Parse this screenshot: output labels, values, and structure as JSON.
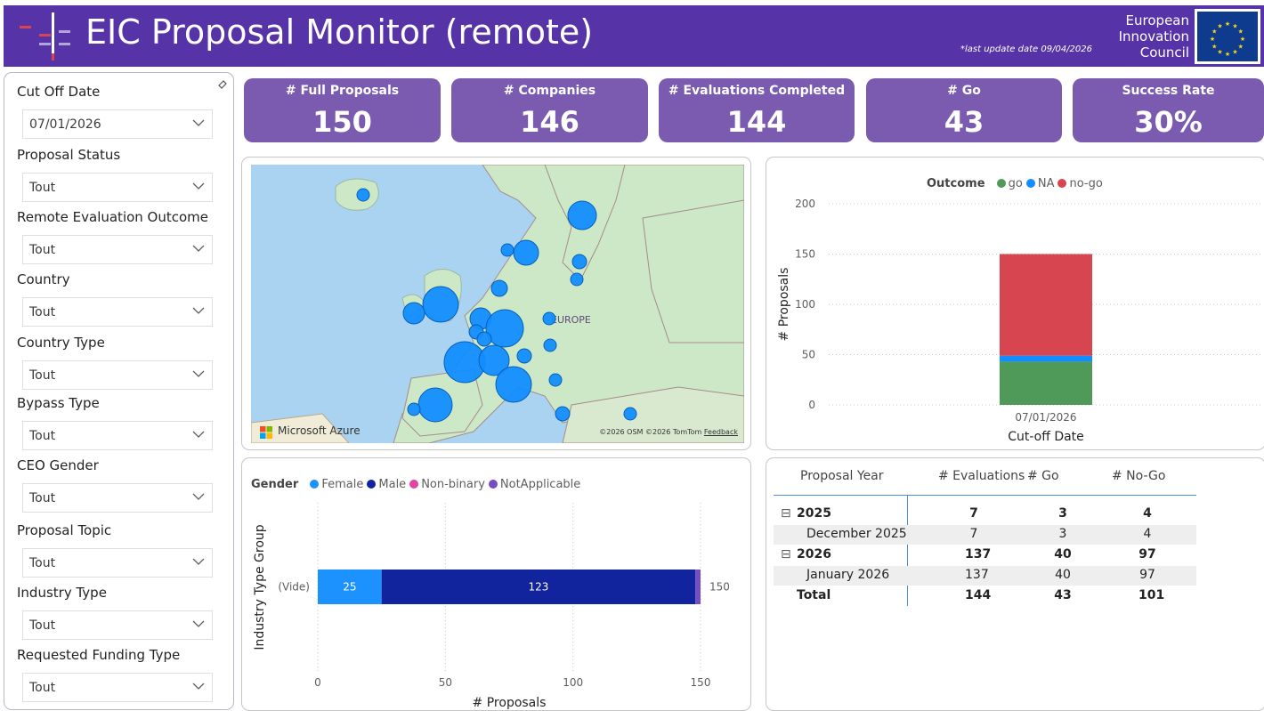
{
  "header": {
    "title": "EIC Proposal Monitor (remote)",
    "last_update": "*last update date 09/04/2026",
    "org_line1": "European",
    "org_line2": "Innovation",
    "org_line3": "Council",
    "logo_icon": "eic-logo-icon",
    "flag_icon": "eu-flag-icon"
  },
  "slicers": [
    {
      "label": "Cut Off Date",
      "value": "07/01/2026"
    },
    {
      "label": "Proposal Status",
      "value": "Tout"
    },
    {
      "label": "Remote Evaluation Outcome",
      "value": "Tout"
    },
    {
      "label": "Country",
      "value": "Tout"
    },
    {
      "label": "Country Type",
      "value": "Tout"
    },
    {
      "label": "Bypass Type",
      "value": "Tout"
    },
    {
      "label": "CEO Gender",
      "value": "Tout"
    },
    {
      "label": "Proposal Topic",
      "value": "Tout"
    },
    {
      "label": "Industry Type",
      "value": "Tout"
    },
    {
      "label": "Requested Funding Type",
      "value": "Tout"
    }
  ],
  "kpis": [
    {
      "label": "# Full Proposals",
      "value": "150"
    },
    {
      "label": "# Companies",
      "value": "146"
    },
    {
      "label": "# Evaluations Completed",
      "value": "144"
    },
    {
      "label": "# Go",
      "value": "43"
    },
    {
      "label": "Success Rate",
      "value": "30%"
    }
  ],
  "map": {
    "region_label": "EUROPE",
    "provider": "Microsoft Azure",
    "credit1": "©2026 OSM",
    "credit2": "©2026 TomTom",
    "credit3": "Feedback",
    "bubble_color": "#118dff"
  },
  "colors": {
    "header": "#5633a7",
    "kpi": "#7a5bb0",
    "go": "#4f9a59",
    "na": "#118dff",
    "nogo": "#d64550",
    "female": "#1c92ff",
    "male": "#12239e",
    "nonbinary": "#e044a7",
    "notapplicable": "#744ec2"
  },
  "outcome_chart": {
    "legend_title": "Outcome",
    "chart_data": {
      "type": "bar",
      "stacked": true,
      "categories": [
        "07/01/2026"
      ],
      "series": [
        {
          "name": "go",
          "values": [
            43
          ]
        },
        {
          "name": "NA",
          "values": [
            6
          ]
        },
        {
          "name": "no-go",
          "values": [
            101
          ]
        }
      ],
      "xlabel": "Cut-off Date",
      "ylabel": "# Proposals",
      "ylim": [
        0,
        200
      ],
      "yticks": [
        "0",
        "50",
        "100",
        "150",
        "200"
      ],
      "grid": true,
      "legend": "top"
    }
  },
  "gender_chart": {
    "legend_title": "Gender",
    "chart_data": {
      "type": "bar",
      "orientation": "horizontal",
      "stacked": true,
      "categories": [
        "(Vide)"
      ],
      "series": [
        {
          "name": "Female",
          "values": [
            25
          ]
        },
        {
          "name": "Male",
          "values": [
            123
          ]
        },
        {
          "name": "Non-binary",
          "values": [
            0
          ]
        },
        {
          "name": "NotApplicable",
          "values": [
            2
          ]
        }
      ],
      "total_label": "150",
      "xlabel": "# Proposals",
      "ylabel": "Industry Type Group",
      "xlim": [
        0,
        150
      ],
      "xticks": [
        "0",
        "50",
        "100",
        "150"
      ],
      "grid": true,
      "legend": "top"
    }
  },
  "table": {
    "headers": [
      "Proposal Year",
      "# Evaluations",
      "# Go",
      "# No-Go"
    ],
    "collapse_icon": "⊟",
    "rows": [
      {
        "label": "2025",
        "evals": "7",
        "go": "3",
        "nogo": "4",
        "kind": "group"
      },
      {
        "label": "December 2025",
        "evals": "7",
        "go": "3",
        "nogo": "4",
        "kind": "child"
      },
      {
        "label": "2026",
        "evals": "137",
        "go": "40",
        "nogo": "97",
        "kind": "group"
      },
      {
        "label": "January 2026",
        "evals": "137",
        "go": "40",
        "nogo": "97",
        "kind": "child"
      },
      {
        "label": "Total",
        "evals": "144",
        "go": "43",
        "nogo": "101",
        "kind": "total"
      }
    ]
  }
}
